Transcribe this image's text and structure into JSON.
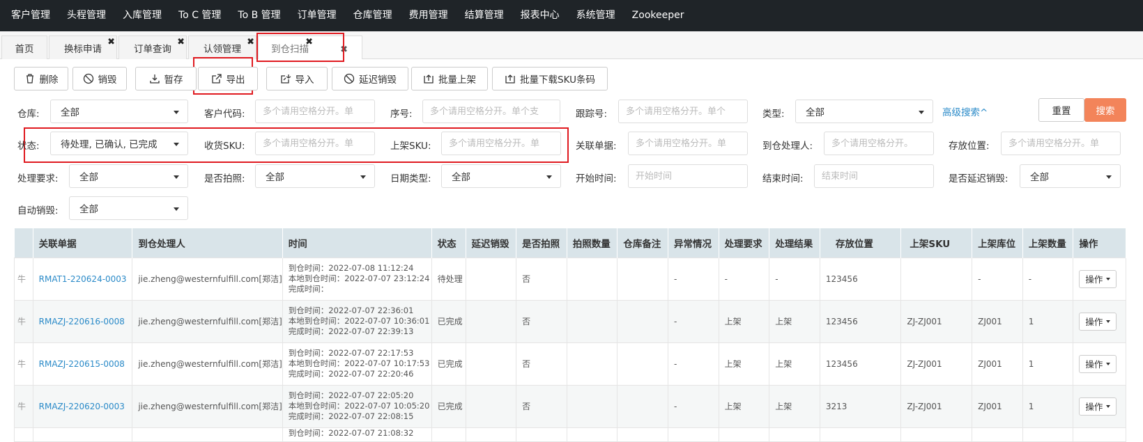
{
  "topnav": [
    "客户管理",
    "头程管理",
    "入库管理",
    "To C 管理",
    "To B 管理",
    "订单管理",
    "仓库管理",
    "费用管理",
    "结算管理",
    "报表中心",
    "系统管理",
    "Zookeeper"
  ],
  "tabs": [
    {
      "label": "首页",
      "closable": false
    },
    {
      "label": "换标申请",
      "closable": true
    },
    {
      "label": "订单查询",
      "closable": true
    },
    {
      "label": "认领管理",
      "closable": true
    },
    {
      "label": "到仓扫描",
      "closable": true,
      "active": true
    }
  ],
  "toolbar": {
    "delete": "删除",
    "destroy": "销毁",
    "save": "暂存",
    "export": "导出",
    "import": "导入",
    "delay_destroy": "延迟销毁",
    "batch_shelve": "批量上架",
    "batch_download": "批量下载SKU条码"
  },
  "filters": {
    "warehouse": {
      "label": "仓库:",
      "value": "全部"
    },
    "customer_code": {
      "label": "客户代码:",
      "placeholder": "多个请用空格分开。单"
    },
    "serial": {
      "label": "序号:",
      "placeholder": "多个请用空格分开。单个支"
    },
    "tracking": {
      "label": "跟踪号:",
      "placeholder": "多个请用空格分开。单个"
    },
    "type": {
      "label": "类型:",
      "value": "全部"
    },
    "advanced": "高级搜索^",
    "reset": "重置",
    "search": "搜索",
    "status": {
      "label": "状态:",
      "value": "待处理, 已确认, 已完成"
    },
    "recv_sku": {
      "label": "收货SKU:",
      "placeholder": "多个请用空格分开。单"
    },
    "shelf_sku": {
      "label": "上架SKU:",
      "placeholder": "多个请用空格分开。单"
    },
    "related": {
      "label": "关联单据:",
      "placeholder": "多个请用空格分开。单"
    },
    "handler": {
      "label": "到仓处理人:",
      "placeholder": "多个请用空格分开。"
    },
    "location": {
      "label": "存放位置:",
      "placeholder": "多个请用空格分开。单"
    },
    "requirement": {
      "label": "处理要求:",
      "value": "全部"
    },
    "photo": {
      "label": "是否拍照:",
      "value": "全部"
    },
    "date_type": {
      "label": "日期类型:",
      "value": "全部"
    },
    "start": {
      "label": "开始时间:",
      "placeholder": "开始时间"
    },
    "end": {
      "label": "结束时间:",
      "placeholder": "结束时间"
    },
    "delay": {
      "label": "是否延迟销毁:",
      "value": "全部"
    },
    "auto_destroy": {
      "label": "自动销毁:",
      "value": "全部"
    }
  },
  "table": {
    "headers": [
      "关联单据",
      "到仓处理人",
      "时间",
      "状态",
      "延迟销毁",
      "是否拍照",
      "拍照数量",
      "仓库备注",
      "异常情况",
      "处理要求",
      "处理结果",
      "存放位置",
      "上架SKU",
      "上架库位",
      "上架数量",
      "操作"
    ],
    "op_label": "操作",
    "rows": [
      {
        "stub": "牛",
        "doc": "RMAT1-220624-0003",
        "handler": "jie.zheng@westernfulfill.com[郑洁]",
        "arrive": "到仓时间：2022-07-08 11:12:24",
        "local": "本地到仓时间：2022-07-07 23:12:24",
        "done": "完成时间：",
        "status": "待处理",
        "delay": "",
        "photo": "否",
        "photo_n": "",
        "remark": "",
        "abn": "-",
        "req": "-",
        "result": "-",
        "loc": "123456",
        "sku": "",
        "bin": "-",
        "qty": "-"
      },
      {
        "stub": "牛",
        "doc": "RMAZJ-220616-0008",
        "handler": "jie.zheng@westernfulfill.com[郑洁]",
        "arrive": "到仓时间：2022-07-07 22:36:01",
        "local": "本地到仓时间：2022-07-07 10:36:01",
        "done": "完成时间：2022-07-07 22:39:13",
        "status": "已完成",
        "delay": "",
        "photo": "否",
        "photo_n": "",
        "remark": "",
        "abn": "-",
        "req": "上架",
        "result": "上架",
        "loc": "123456",
        "sku": "ZJ-ZJ001",
        "bin": "ZJ001",
        "qty": "1"
      },
      {
        "stub": "牛",
        "doc": "RMAZJ-220615-0008",
        "handler": "jie.zheng@westernfulfill.com[郑洁]",
        "arrive": "到仓时间：2022-07-07 22:17:53",
        "local": "本地到仓时间：2022-07-07 10:17:53",
        "done": "完成时间：2022-07-07 22:20:46",
        "status": "已完成",
        "delay": "",
        "photo": "否",
        "photo_n": "",
        "remark": "",
        "abn": "-",
        "req": "上架",
        "result": "上架",
        "loc": "123456",
        "sku": "ZJ-ZJ001",
        "bin": "ZJ001",
        "qty": "1"
      },
      {
        "stub": "牛",
        "doc": "RMAZJ-220620-0003",
        "handler": "jie.zheng@westernfulfill.com[郑洁]",
        "arrive": "到仓时间：2022-07-07 22:05:20",
        "local": "本地到仓时间：2022-07-07 10:05:20",
        "done": "完成时间：2022-07-07 22:08:15",
        "status": "已完成",
        "delay": "",
        "photo": "否",
        "photo_n": "",
        "remark": "",
        "abn": "-",
        "req": "上架",
        "result": "上架",
        "loc": "3213",
        "sku": "ZJ-ZJ001",
        "bin": "ZJ001",
        "qty": "1"
      }
    ],
    "partial_row": "到仓时间：2022-07-07 21:08:32"
  }
}
